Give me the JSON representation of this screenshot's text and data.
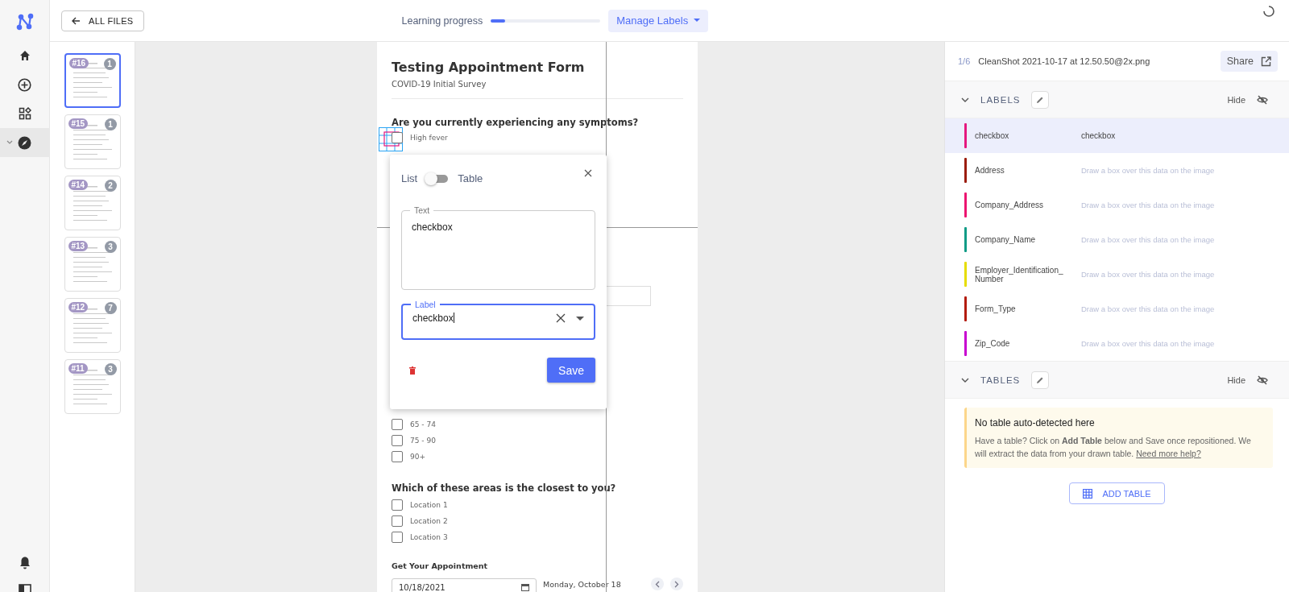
{
  "nav": {
    "items": [
      {
        "kind": "home",
        "selected": false
      },
      {
        "kind": "add",
        "selected": false
      },
      {
        "kind": "apps",
        "selected": false
      },
      {
        "kind": "explore",
        "selected": true
      }
    ]
  },
  "top_bar": {
    "back_button": "ALL FILES",
    "progress_label": "Learning progress",
    "progress": {
      "level": 0.13
    },
    "labels_menu": "Manage Labels"
  },
  "thumbnails": [
    {
      "number": "#16",
      "count": "1",
      "selected": true
    },
    {
      "number": "#15",
      "count": "1",
      "selected": false
    },
    {
      "number": "#14",
      "count": "2",
      "selected": false
    },
    {
      "number": "#13",
      "count": "3",
      "selected": false
    },
    {
      "number": "#12",
      "count": "7",
      "selected": false
    },
    {
      "number": "#11",
      "count": "3",
      "selected": false
    }
  ],
  "document": {
    "title": "Testing Appointment Form",
    "subtitle": "COVID-19 Initial Survey",
    "question_1": "Are you currently experiencing any symptoms?",
    "symptom_options": [
      {
        "label": "High fever",
        "checked": false
      }
    ],
    "age_options": [
      {
        "label": "65 - 74",
        "checked": false
      },
      {
        "label": "75 - 90",
        "checked": false
      },
      {
        "label": "90+",
        "checked": false
      }
    ],
    "question_2": "Which of these areas is the closest to you?",
    "location_options": [
      {
        "label": "Location 1",
        "checked": false
      },
      {
        "label": "Location 2",
        "checked": false
      },
      {
        "label": "Location 3",
        "checked": false
      }
    ],
    "appointment_label": "Get Your Appointment",
    "date_value": "10/18/2021",
    "day_label": "Monday, October 18"
  },
  "dialog": {
    "mode_left": "List",
    "mode_right": "Table",
    "table_mode": false,
    "text_legend": "Text",
    "text_value": "checkbox",
    "label_legend": "Label",
    "label_value": "checkbox",
    "save": "Save"
  },
  "file_header": {
    "position": "1/6",
    "filename": "CleanShot 2021-10-17 at 12.50.50@2x.png",
    "share": "Share"
  },
  "labels_section": {
    "title": "LABELS",
    "hide": "Hide",
    "expanded": true,
    "items": [
      {
        "name": "checkbox",
        "value": "checkbox",
        "color": "#e5177f",
        "selected": true
      },
      {
        "name": "Address",
        "placeholder": "Draw a box over this data on the image",
        "color": "#9b1c0c",
        "selected": false
      },
      {
        "name": "Company_Address",
        "placeholder": "Draw a box over this data on the image",
        "color": "#ec1470",
        "selected": false
      },
      {
        "name": "Company_Name",
        "placeholder": "Draw a box over this data on the image",
        "color": "#0e9b86",
        "selected": false
      },
      {
        "name": "Employer_Identification_ Number",
        "placeholder": "Draw a box over this data on the image",
        "color": "#e6dd00",
        "selected": false
      },
      {
        "name": "Form_Type",
        "placeholder": "Draw a box over this data on the image",
        "color": "#b31b0b",
        "selected": false
      },
      {
        "name": "Zip_Code",
        "placeholder": "Draw a box over this data on the image",
        "color": "#c700d0",
        "selected": false
      }
    ]
  },
  "tables_section": {
    "title": "TABLES",
    "hide": "Hide",
    "expanded": true,
    "notice": {
      "title": "No table auto-detected here",
      "text": "Have a table? Click on **Add Table** below and Save once repositioned. We will extract the data from your drawn table.",
      "link": "Need more help?"
    },
    "add_button": "ADD TABLE"
  }
}
